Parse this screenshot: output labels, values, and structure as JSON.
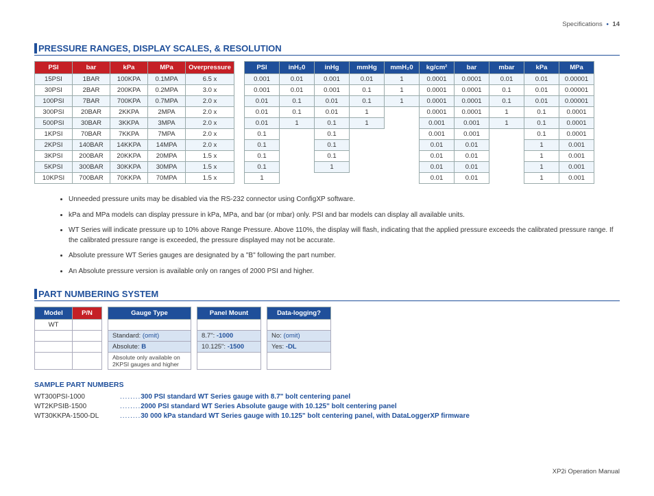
{
  "header": {
    "left": "Specifications",
    "right": "14"
  },
  "section1_title": "PRESSURE RANGES, DISPLAY SCALES, & RESOLUTION",
  "t1_headers": [
    "PSI",
    "bar",
    "kPa",
    "MPa",
    "Overpressure"
  ],
  "t1_rows": [
    [
      "15PSI",
      "1BAR",
      "100KPA",
      "0.1MPA",
      "6.5 x"
    ],
    [
      "30PSI",
      "2BAR",
      "200KPA",
      "0.2MPA",
      "3.0 x"
    ],
    [
      "100PSI",
      "7BAR",
      "700KPA",
      "0.7MPA",
      "2.0 x"
    ],
    [
      "300PSI",
      "20BAR",
      "2KKPA",
      "2MPA",
      "2.0 x"
    ],
    [
      "500PSI",
      "30BAR",
      "3KKPA",
      "3MPA",
      "2.0 x"
    ],
    [
      "1KPSI",
      "70BAR",
      "7KKPA",
      "7MPA",
      "2.0 x"
    ],
    [
      "2KPSI",
      "140BAR",
      "14KKPA",
      "14MPA",
      "2.0 x"
    ],
    [
      "3KPSI",
      "200BAR",
      "20KKPA",
      "20MPA",
      "1.5 x"
    ],
    [
      "5KPSI",
      "300BAR",
      "30KKPA",
      "30MPA",
      "1.5 x"
    ],
    [
      "10KPSI",
      "700BAR",
      "70KKPA",
      "70MPA",
      "1.5 x"
    ]
  ],
  "t2_headers": [
    "PSI",
    "inH₂0",
    "inHg",
    "mmHg",
    "mmH₂0",
    "kg/cm²",
    "bar",
    "mbar",
    "kPa",
    "MPa"
  ],
  "t2_rows": [
    [
      "0.001",
      "0.01",
      "0.001",
      "0.01",
      "1",
      "0.0001",
      "0.0001",
      "0.01",
      "0.01",
      "0.00001"
    ],
    [
      "0.001",
      "0.01",
      "0.001",
      "0.1",
      "1",
      "0.0001",
      "0.0001",
      "0.1",
      "0.01",
      "0.00001"
    ],
    [
      "0.01",
      "0.1",
      "0.01",
      "0.1",
      "1",
      "0.0001",
      "0.0001",
      "0.1",
      "0.01",
      "0.00001"
    ],
    [
      "0.01",
      "0.1",
      "0.01",
      "1",
      "",
      "0.0001",
      "0.0001",
      "1",
      "0.1",
      "0.0001"
    ],
    [
      "0.01",
      "1",
      "0.1",
      "1",
      "",
      "0.001",
      "0.001",
      "1",
      "0.1",
      "0.0001"
    ],
    [
      "0.1",
      "",
      "0.1",
      "",
      "",
      "0.001",
      "0.001",
      "",
      "0.1",
      "0.0001"
    ],
    [
      "0.1",
      "",
      "0.1",
      "",
      "",
      "0.01",
      "0.01",
      "",
      "1",
      "0.001"
    ],
    [
      "0.1",
      "",
      "0.1",
      "",
      "",
      "0.01",
      "0.01",
      "",
      "1",
      "0.001"
    ],
    [
      "0.1",
      "",
      "1",
      "",
      "",
      "0.01",
      "0.01",
      "",
      "1",
      "0.001"
    ],
    [
      "1",
      "",
      "",
      "",
      "",
      "0.01",
      "0.01",
      "",
      "1",
      "0.001"
    ]
  ],
  "notes": [
    "Unneeded pressure units may be disabled via the RS-232 connector using ConfigXP software.",
    "kPa and MPa models can display pressure in kPa, MPa, and bar (or mbar) only. PSI and bar models can display all available units.",
    "WT Series will indicate pressure up to 10% above Range Pressure. Above 110%, the display will flash, indicating that the applied pressure exceeds the calibrated pressure range. If the calibrated pressure range is exceeded, the pressure displayed may not be accurate.",
    "Absolute pressure WT Series gauges are designated by a \"B\" following the part number.",
    "An Absolute pressure version is available only on ranges of 2000 PSI and higher."
  ],
  "section2_title": "PART NUMBERING SYSTEM",
  "pn_headers": [
    "Model",
    "P/N",
    "Gauge Type",
    "Panel Mount",
    "Data-logging?"
  ],
  "pn_model": "WT",
  "gauge_opts": [
    {
      "l": "Standard:",
      "r": "(omit)"
    },
    {
      "l": "Absolute:",
      "r": "B"
    }
  ],
  "gauge_note": "Absolute only available on 2KPSI gauges and higher",
  "panel_opts": [
    {
      "l": "8.7\":",
      "r": "-1000"
    },
    {
      "l": "10.125\":",
      "r": "-1500"
    }
  ],
  "dl_opts": [
    {
      "l": "No:",
      "r": "(omit)"
    },
    {
      "l": "Yes:",
      "r": "-DL"
    }
  ],
  "samples_title": "SAMPLE PART NUMBERS",
  "samples": [
    {
      "pn": "WT300PSI-1000",
      "desc": "300 PSI standard WT Series gauge with 8.7\" bolt centering panel"
    },
    {
      "pn": "WT2KPSIB-1500",
      "desc": "2000 PSI standard WT Series Absolute gauge with 10.125\" bolt centering panel"
    },
    {
      "pn": "WT30KKPA-1500-DL",
      "desc": "30 000 kPa standard WT Series gauge with 10.125\" bolt centering panel, with DataLoggerXP firmware"
    }
  ],
  "footer": "XP2i Operation Manual"
}
